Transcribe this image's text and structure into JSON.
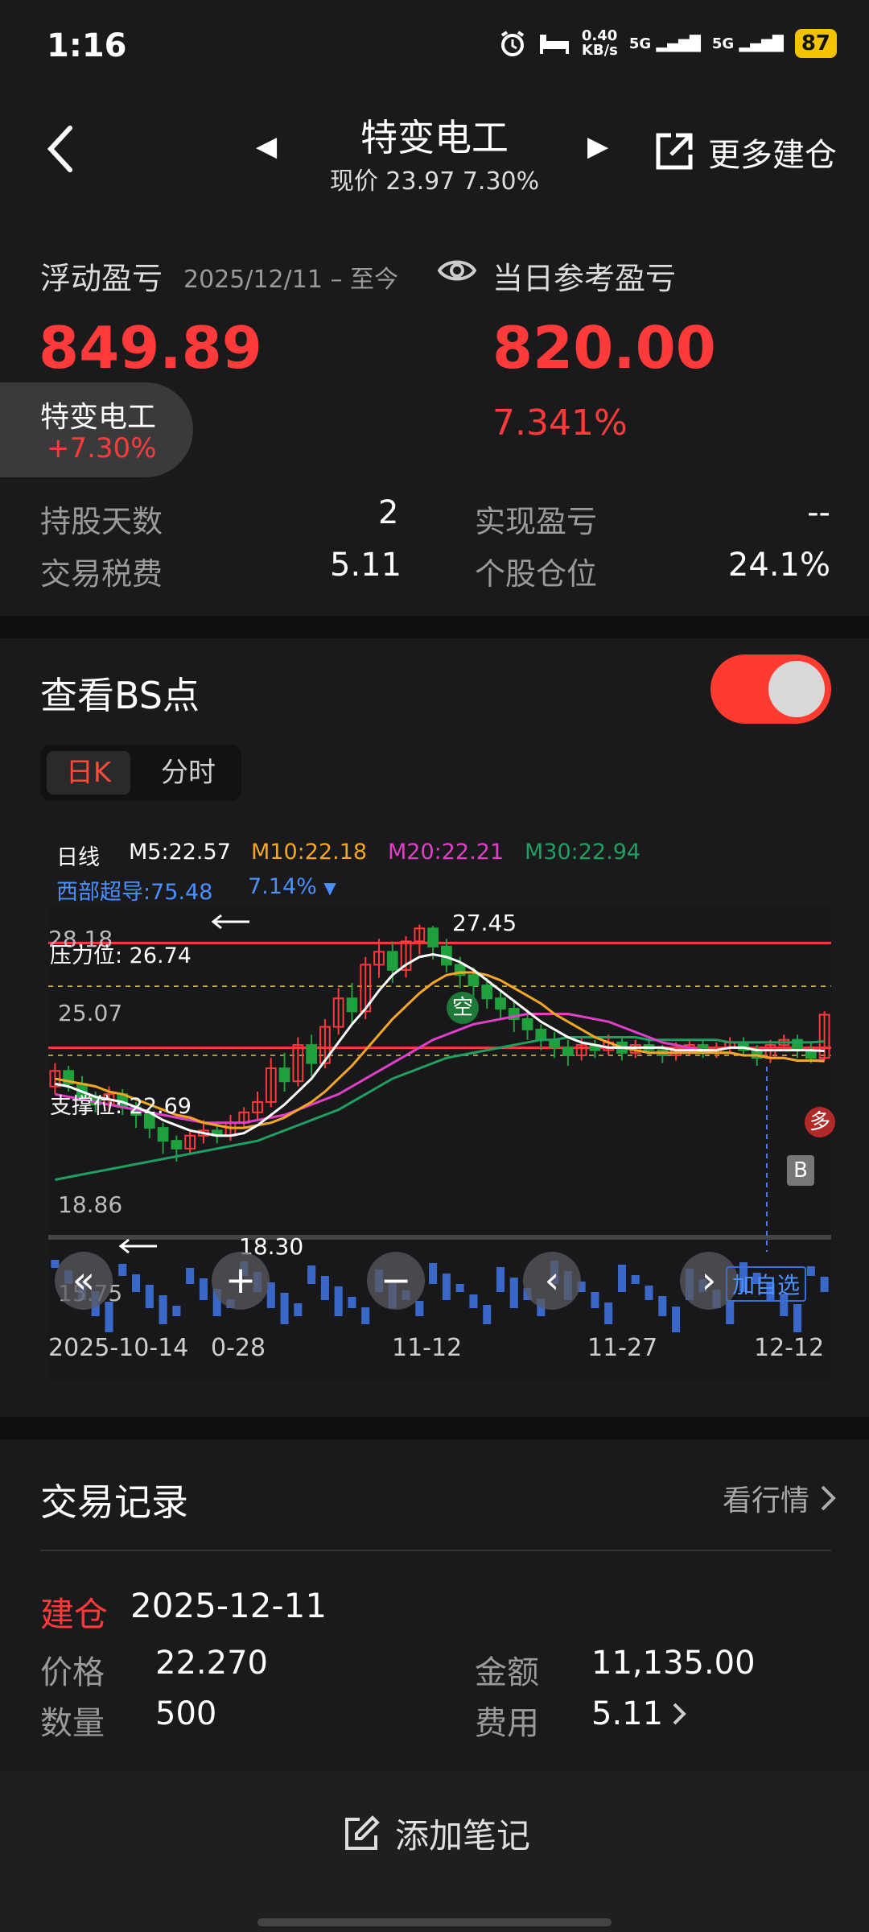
{
  "status": {
    "time": "1:16",
    "speed_top": "0.40",
    "speed_unit": "KB/s",
    "signal1": "5G",
    "signal2": "5G",
    "battery": "87"
  },
  "header": {
    "title": "特变电工",
    "subtitle": "现价 23.97 7.30%",
    "more_label": "更多建仓"
  },
  "pnl": {
    "floating_label": "浮动盈亏",
    "date_range": "2025/12/11 – 至今",
    "daily_label": "当日参考盈亏",
    "floating_value": "849.89",
    "daily_value": "820.00",
    "daily_pct": "7.341%",
    "pill_name": "特变电工",
    "pill_pct": "+7.30%",
    "hold_days_label": "持股天数",
    "hold_days": "2",
    "realized_label": "实现盈亏",
    "realized": "--",
    "fee_label": "交易税费",
    "fee": "5.11",
    "position_label": "个股仓位",
    "position": "24.1%"
  },
  "bs": {
    "title": "查看BS点",
    "switch_on": true,
    "tab_day": "日K",
    "tab_min": "分时"
  },
  "legend": {
    "period": "日线",
    "m5": "M5:22.57",
    "m10": "M10:22.18",
    "m20": "M20:22.21",
    "m30": "M30:22.94",
    "compare": "西部超导:75.48",
    "compare_pct": "7.14%",
    "colors": {
      "m5": "#ffffff",
      "m10": "#f5a623",
      "m20": "#e040c8",
      "m30": "#20a060",
      "compare": "#4a90ff"
    }
  },
  "chart_labels": {
    "y_top": "28.18",
    "y_25": "25.07",
    "y_low": "18.86",
    "y_bottom": "15.75",
    "pressure": "压力位: 26.74",
    "support": "支撑位: 22.69",
    "high_note": "27.45",
    "low_note": "18.30",
    "x_ticks": [
      "2025-10-14",
      "0-28",
      "11-12",
      "11-27",
      "12-12"
    ],
    "add_fav": "加自选",
    "buy_marker": "B",
    "duo": "多",
    "kong": "空"
  },
  "chart_data": {
    "type": "candlestick",
    "ylim": [
      15.75,
      28.18
    ],
    "pressure_line": 26.74,
    "support_line": 22.69,
    "candles": [
      [
        21.2,
        21.8,
        20.9,
        22.1
      ],
      [
        21.8,
        21.3,
        21.0,
        22.0
      ],
      [
        21.3,
        20.8,
        20.5,
        21.6
      ],
      [
        20.8,
        20.5,
        20.2,
        21.0
      ],
      [
        20.5,
        20.9,
        20.3,
        21.2
      ],
      [
        20.9,
        20.4,
        20.1,
        21.1
      ],
      [
        20.4,
        20.1,
        19.6,
        20.6
      ],
      [
        20.1,
        19.6,
        19.2,
        20.3
      ],
      [
        19.6,
        19.1,
        18.6,
        19.8
      ],
      [
        19.1,
        18.8,
        18.3,
        19.3
      ],
      [
        18.8,
        19.3,
        18.6,
        19.5
      ],
      [
        19.3,
        19.5,
        19.0,
        19.9
      ],
      [
        19.5,
        19.3,
        19.0,
        19.8
      ],
      [
        19.3,
        19.8,
        19.1,
        20.1
      ],
      [
        19.8,
        20.2,
        19.6,
        20.4
      ],
      [
        20.2,
        20.6,
        19.9,
        21.0
      ],
      [
        20.6,
        21.9,
        20.4,
        22.3
      ],
      [
        21.9,
        21.4,
        21.0,
        22.5
      ],
      [
        21.4,
        22.8,
        21.2,
        23.1
      ],
      [
        22.8,
        22.1,
        21.6,
        23.2
      ],
      [
        22.1,
        23.5,
        21.9,
        23.8
      ],
      [
        23.5,
        24.6,
        23.2,
        25.0
      ],
      [
        24.6,
        24.1,
        23.6,
        25.2
      ],
      [
        24.1,
        25.9,
        23.8,
        26.2
      ],
      [
        25.9,
        26.4,
        25.4,
        26.9
      ],
      [
        26.4,
        25.7,
        25.2,
        26.8
      ],
      [
        25.7,
        26.8,
        25.4,
        27.0
      ],
      [
        26.8,
        27.3,
        26.3,
        27.45
      ],
      [
        27.3,
        26.6,
        26.1,
        27.4
      ],
      [
        26.6,
        25.9,
        25.6,
        26.9
      ],
      [
        25.9,
        25.5,
        25.0,
        26.2
      ],
      [
        25.5,
        25.1,
        24.6,
        25.8
      ],
      [
        25.1,
        24.6,
        24.2,
        25.4
      ],
      [
        24.6,
        24.2,
        23.8,
        24.9
      ],
      [
        24.2,
        23.8,
        23.3,
        24.5
      ],
      [
        23.8,
        23.4,
        23.0,
        24.1
      ],
      [
        23.4,
        23.0,
        22.6,
        23.6
      ],
      [
        23.0,
        22.7,
        22.3,
        23.3
      ],
      [
        22.7,
        22.4,
        22.0,
        23.0
      ],
      [
        22.4,
        22.8,
        22.2,
        23.1
      ],
      [
        22.8,
        22.6,
        22.3,
        23.0
      ],
      [
        22.6,
        22.9,
        22.4,
        23.2
      ],
      [
        22.9,
        22.5,
        22.2,
        23.1
      ],
      [
        22.5,
        22.8,
        22.3,
        23.0
      ],
      [
        22.8,
        22.6,
        22.4,
        23.0
      ],
      [
        22.6,
        22.4,
        22.1,
        22.8
      ],
      [
        22.4,
        22.6,
        22.2,
        22.9
      ],
      [
        22.6,
        22.8,
        22.4,
        23.0
      ],
      [
        22.8,
        22.5,
        22.3,
        23.0
      ],
      [
        22.5,
        22.7,
        22.3,
        22.9
      ],
      [
        22.7,
        22.9,
        22.5,
        23.1
      ],
      [
        22.9,
        22.6,
        22.4,
        23.1
      ],
      [
        22.6,
        22.3,
        22.0,
        22.8
      ],
      [
        22.3,
        22.8,
        22.1,
        23.0
      ],
      [
        22.8,
        23.0,
        22.6,
        23.2
      ],
      [
        23.0,
        22.6,
        22.3,
        23.2
      ],
      [
        22.6,
        22.3,
        22.1,
        22.9
      ],
      [
        22.3,
        23.97,
        22.2,
        24.1
      ]
    ],
    "ma5": [
      21.3,
      21.2,
      21.0,
      20.8,
      20.7,
      20.6,
      20.4,
      20.2,
      19.9,
      19.7,
      19.5,
      19.4,
      19.3,
      19.3,
      19.4,
      19.7,
      20.1,
      20.5,
      21.0,
      21.5,
      22.2,
      22.9,
      23.6,
      24.2,
      24.9,
      25.5,
      25.9,
      26.2,
      26.3,
      26.2,
      26.0,
      25.7,
      25.3,
      24.9,
      24.5,
      24.1,
      23.7,
      23.4,
      23.1,
      22.9,
      22.8,
      22.7,
      22.7,
      22.7,
      22.7,
      22.7,
      22.6,
      22.6,
      22.6,
      22.6,
      22.7,
      22.7,
      22.6,
      22.6,
      22.6,
      22.6,
      22.6,
      22.57
    ],
    "ma10": [
      21.5,
      21.4,
      21.3,
      21.2,
      21.0,
      20.9,
      20.7,
      20.5,
      20.3,
      20.1,
      20.0,
      19.8,
      19.7,
      19.6,
      19.6,
      19.7,
      19.8,
      20.0,
      20.3,
      20.6,
      21.0,
      21.5,
      22.0,
      22.6,
      23.2,
      23.8,
      24.3,
      24.8,
      25.2,
      25.5,
      25.6,
      25.6,
      25.5,
      25.3,
      25.0,
      24.7,
      24.4,
      24.0,
      23.7,
      23.4,
      23.1,
      22.9,
      22.7,
      22.6,
      22.5,
      22.5,
      22.5,
      22.5,
      22.5,
      22.5,
      22.5,
      22.4,
      22.4,
      22.3,
      22.3,
      22.2,
      22.2,
      22.18
    ],
    "ma20": [
      20.9,
      20.8,
      20.7,
      20.6,
      20.5,
      20.4,
      20.3,
      20.2,
      20.1,
      20.0,
      19.9,
      19.8,
      19.8,
      19.8,
      19.8,
      19.9,
      20.0,
      20.1,
      20.3,
      20.5,
      20.7,
      20.9,
      21.2,
      21.5,
      21.8,
      22.1,
      22.4,
      22.7,
      23.0,
      23.2,
      23.4,
      23.6,
      23.7,
      23.8,
      23.9,
      24.0,
      24.0,
      24.0,
      24.0,
      23.9,
      23.8,
      23.7,
      23.5,
      23.3,
      23.1,
      22.9,
      22.8,
      22.7,
      22.6,
      22.5,
      22.5,
      22.4,
      22.4,
      22.3,
      22.3,
      22.2,
      22.2,
      22.21
    ],
    "ma30": [
      17.6,
      17.7,
      17.8,
      17.9,
      18.0,
      18.1,
      18.2,
      18.3,
      18.4,
      18.5,
      18.6,
      18.7,
      18.8,
      18.9,
      19.0,
      19.1,
      19.3,
      19.5,
      19.7,
      19.9,
      20.1,
      20.3,
      20.6,
      20.9,
      21.2,
      21.5,
      21.7,
      21.9,
      22.1,
      22.3,
      22.4,
      22.5,
      22.6,
      22.7,
      22.8,
      22.9,
      23.0,
      23.0,
      23.1,
      23.1,
      23.1,
      23.1,
      23.1,
      23.1,
      23.0,
      23.0,
      23.0,
      23.0,
      23.0,
      23.0,
      22.9,
      22.9,
      22.9,
      22.9,
      22.9,
      22.9,
      22.9,
      22.94
    ]
  },
  "trades": {
    "title": "交易记录",
    "market_link": "看行情",
    "entry_type": "建仓",
    "entry_date": "2025-12-11",
    "price_label": "价格",
    "price": "22.270",
    "amount_label": "金额",
    "amount": "11,135.00",
    "qty_label": "数量",
    "qty": "500",
    "cost_label": "费用",
    "cost": "5.11"
  },
  "footer": {
    "add_note": "添加笔记"
  }
}
